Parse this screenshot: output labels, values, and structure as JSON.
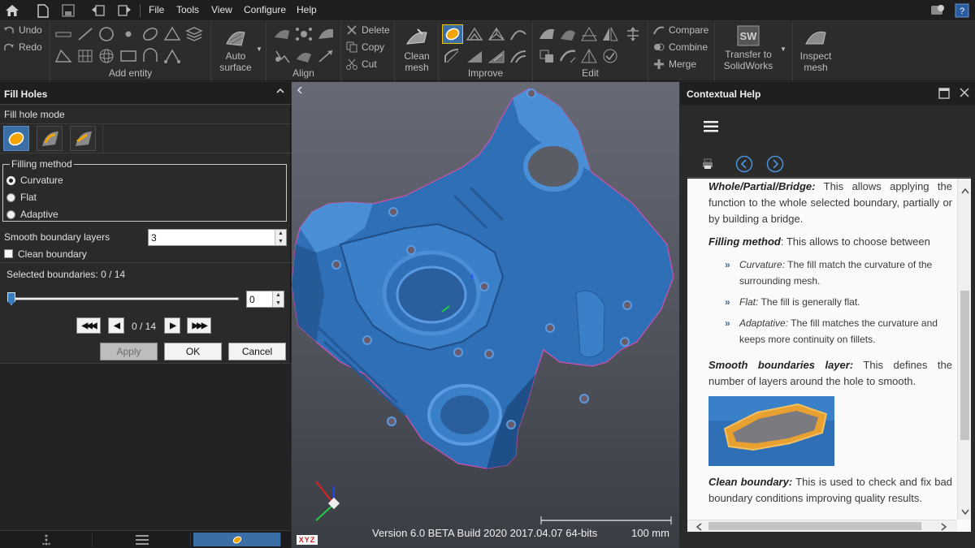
{
  "menubar": {
    "items": [
      "File",
      "Tools",
      "View",
      "Configure",
      "Help"
    ]
  },
  "ribbon": {
    "undo_label": "Undo",
    "redo_label": "Redo",
    "groups": {
      "add_entity": "Add entity",
      "align": "Align",
      "improve": "Improve",
      "edit": "Edit"
    },
    "auto_surface_label": "Auto surface",
    "delete_label": "Delete",
    "copy_label": "Copy",
    "cut_label": "Cut",
    "clean_mesh_label": "Clean mesh",
    "compare_label": "Compare",
    "combine_label": "Combine",
    "merge_label": "Merge",
    "transfer_label": "Transfer to SolidWorks",
    "inspect_label": "Inspect mesh"
  },
  "left_panel": {
    "title": "Fill Holes",
    "fill_hole_mode_label": "Fill hole mode",
    "filling_method_label": "Filling method",
    "filling_methods": [
      {
        "label": "Curvature",
        "selected": true
      },
      {
        "label": "Flat",
        "selected": false
      },
      {
        "label": "Adaptive",
        "selected": false
      }
    ],
    "smooth_boundary_label": "Smooth boundary layers",
    "smooth_boundary_value": "3",
    "clean_boundary_label": "Clean boundary",
    "clean_boundary_checked": false,
    "selected_boundaries_label": "Selected boundaries: 0 / 14",
    "slider_value": "0",
    "nav_counter": "0 / 14",
    "apply_label": "Apply",
    "ok_label": "OK",
    "cancel_label": "Cancel"
  },
  "viewport": {
    "version_text": "Version 6.0 BETA Build 2020 2017.04.07 64-bits",
    "scale_label": "100 mm",
    "axis_labels": "XYZ"
  },
  "help_panel": {
    "title": "Contextual Help",
    "para1_term": "Whole/Partial/Bridge:",
    "para1_text": " This allows applying the function to the whole selected boundary, partially or by building a bridge.",
    "para2_term": "Filling method",
    "para2_text": ": This allows to choose between",
    "bullets": [
      {
        "term": "Curvature:",
        "text": " The fill match the curvature of the surrounding mesh."
      },
      {
        "term": "Flat:",
        "text": " The fill is generally flat."
      },
      {
        "term": "Adaptative:",
        "text": " The fill matches the curvature and keeps more continuity on fillets."
      }
    ],
    "para3_term": "Smooth boundaries layer:",
    "para3_text": " This defines the number of layers around the hole to smooth.",
    "para4_term": "Clean boundary:",
    "para4_text": " This is used to check and fix bad boundary conditions improving quality results."
  },
  "colors": {
    "mesh_blue": "#3a7cc0",
    "accent": "#3a6ea5",
    "link_blue": "#4a90d9"
  }
}
